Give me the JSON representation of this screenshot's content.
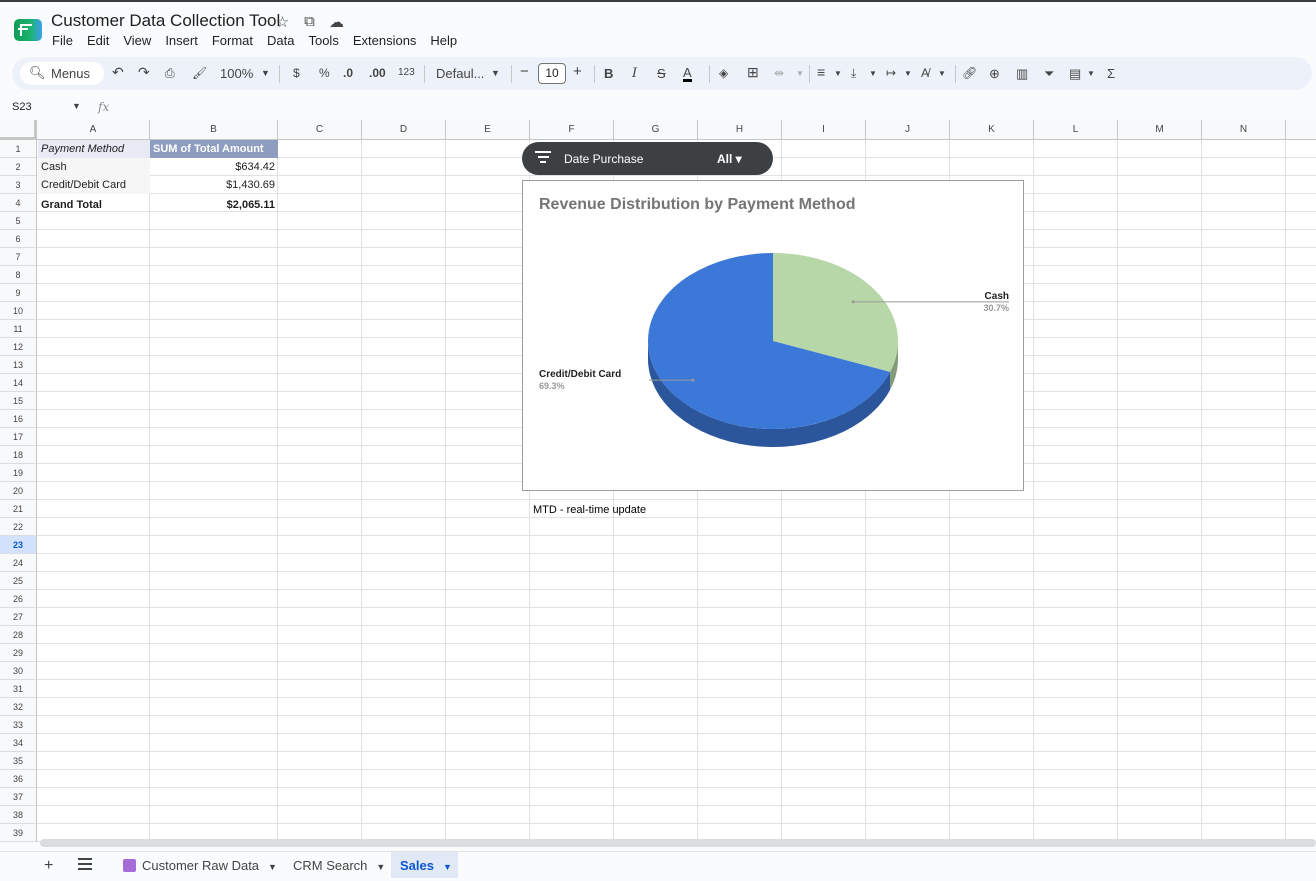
{
  "app": {
    "title": "Customer Data Collection Tool",
    "menu": [
      "File",
      "Edit",
      "View",
      "Insert",
      "Format",
      "Data",
      "Tools",
      "Extensions",
      "Help"
    ]
  },
  "toolbar": {
    "menus_label": "Menus",
    "zoom": "100%",
    "currency": "$",
    "percent": "%",
    "dec_decrease": ".0",
    "dec_increase": ".00",
    "number_format": "123",
    "font": "Defaul...",
    "font_size": "10",
    "bold": "B",
    "italic": "I",
    "strike": "S",
    "text_color": "A",
    "sigma": "Σ"
  },
  "formula_bar": {
    "cell_ref": "S23",
    "fx": "fx"
  },
  "grid": {
    "columns": [
      "A",
      "B",
      "C",
      "D",
      "E",
      "F",
      "G",
      "H",
      "I",
      "J",
      "K",
      "L",
      "M",
      "N"
    ],
    "rows": [
      "1",
      "2",
      "3",
      "4",
      "5",
      "6",
      "7",
      "8",
      "9",
      "10",
      "11",
      "12",
      "13",
      "14",
      "15",
      "16",
      "17",
      "18",
      "19",
      "20",
      "21",
      "22",
      "23",
      "24",
      "25",
      "26",
      "27",
      "28",
      "29",
      "30",
      "31",
      "32",
      "33",
      "34",
      "35",
      "36",
      "37",
      "38",
      "39"
    ],
    "selected_row": "23"
  },
  "pivot": {
    "header_label": "Payment Method",
    "header_value": "SUM of Total Amount",
    "rows": [
      {
        "label": "Cash",
        "value": "$634.42"
      },
      {
        "label": "Credit/Debit Card",
        "value": "$1,430.69"
      }
    ],
    "grand_total_label": "Grand Total",
    "grand_total_value": "$2,065.11"
  },
  "filter": {
    "label": "Date Purchase",
    "value": "All"
  },
  "chart_data": {
    "type": "pie",
    "title": "Revenue Distribution by Payment Method",
    "categories": [
      "Cash",
      "Credit/Debit Card"
    ],
    "values": [
      30.7,
      69.3
    ],
    "labels": [
      "30.7%",
      "69.3%"
    ],
    "colors": [
      "#b7d7a8",
      "#3c78d8"
    ]
  },
  "caption": "MTD - real-time update",
  "sheets": [
    {
      "name": "Customer Raw Data",
      "active": false
    },
    {
      "name": "CRM Search",
      "active": false
    },
    {
      "name": "Sales",
      "active": true
    }
  ]
}
